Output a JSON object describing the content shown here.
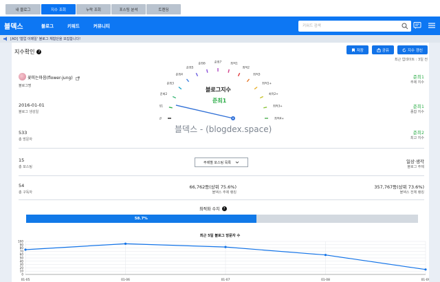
{
  "tabs": [
    {
      "label": "내 블로그",
      "active": false
    },
    {
      "label": "지수 조회",
      "active": true
    },
    {
      "label": "누락 조회",
      "active": false
    },
    {
      "label": "포스팅 분석",
      "active": false
    },
    {
      "label": "트렌딩",
      "active": false
    }
  ],
  "nav": {
    "brand": "블덱스",
    "links": [
      "블로그",
      "키워드",
      "커뮤니티"
    ],
    "search_placeholder": "키워드 검색"
  },
  "banner": {
    "text": "[AD] '협업 이메일' 블로그 체험단을 모집합니다!"
  },
  "header": {
    "title": "지수확인",
    "buttons": [
      "저장",
      "공유",
      "지수 갱신"
    ],
    "updated": "최근 업데이트 : 3일 전"
  },
  "profile": {
    "name": "꽃피는마음(flower-jung)",
    "label": "블로그명"
  },
  "left_stats": [
    {
      "value": "2016-01-01",
      "label": "블로그 생성일"
    },
    {
      "value": "533",
      "label": "총 방문자"
    },
    {
      "value": "15",
      "label": "총 포스팅"
    },
    {
      "value": "54",
      "label": "총 구독자"
    }
  ],
  "right_stats": [
    {
      "value": "준최1",
      "label": "주제 지수"
    },
    {
      "value": "준최1",
      "label": "종합 지수"
    },
    {
      "value": "준최2",
      "label": "최고 지수"
    },
    {
      "value": "일상·생각",
      "label": "블로그 주제"
    },
    {
      "value": "357,767등(상위 73.6%)",
      "label": "블덱스 전체 랭킹"
    }
  ],
  "mid_stat": {
    "value": "66,762등(상위 75.6%)",
    "label": "블덱스 주제 랭킹"
  },
  "gauge": {
    "title": "블로그지수",
    "value": "준최1",
    "watermark": "블덱스 - (blogdex.space)",
    "levels": [
      "일반",
      "준최1",
      "준최2",
      "준최3",
      "준최4",
      "준최5",
      "준최6",
      "준최7",
      "최적1",
      "최적2",
      "최적3",
      "최적1+",
      "최적2+",
      "최적3+",
      "최적4+"
    ],
    "colors": [
      "#222222",
      "#2fae4a",
      "#3cb878",
      "#1aa3c9",
      "#3f7fe0",
      "#6b5fe0",
      "#8a4fd8",
      "#b04ac4",
      "#d13e8a",
      "#e0383a",
      "#e6792b",
      "#e8b02a",
      "#c9c430",
      "#8ac43a",
      "#4caf50"
    ],
    "needle_level": 1.35
  },
  "select": {
    "label": "주제별 포스팅 목록"
  },
  "optimization": {
    "title": "최적화 수치",
    "percent": "58.7%",
    "fraction": 0.587
  },
  "chart_data": {
    "type": "line",
    "title": "최근 5일 블로그 방문자 수",
    "categories": [
      "01-05",
      "01-06",
      "01-07",
      "01-08",
      "01-09"
    ],
    "values": [
      75,
      93,
      83,
      59,
      15
    ],
    "ylim": [
      0,
      100
    ],
    "yticks": [
      "0",
      "10",
      "20",
      "30",
      "40",
      "50",
      "60",
      "70",
      "80",
      "90",
      "100"
    ],
    "color": "#1273e8",
    "grid": true
  }
}
